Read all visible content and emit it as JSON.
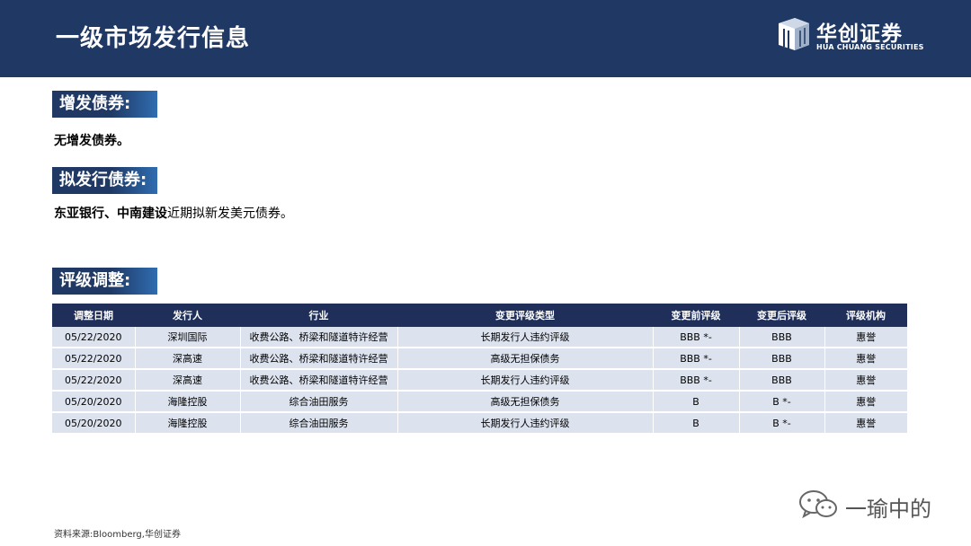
{
  "header": {
    "title": "一级市场发行信息",
    "logo_cn": "华创证券",
    "logo_en": "HUA CHUANG SECURITIES"
  },
  "sections": {
    "additional_issue": {
      "label": "增发债券:",
      "text": "无增发债券。"
    },
    "planned_issue": {
      "label": "拟发行债券:",
      "text_bold": "东亚银行、中南建设",
      "text_rest": "近期拟新发美元债券。"
    },
    "rating_changes": {
      "label": "评级调整:"
    }
  },
  "table": {
    "headers": [
      "调整日期",
      "发行人",
      "行业",
      "变更评级类型",
      "变更前评级",
      "变更后评级",
      "评级机构"
    ],
    "rows": [
      [
        "05/22/2020",
        "深圳国际",
        "收费公路、桥梁和隧道特许经营",
        "长期发行人违约评级",
        "BBB *-",
        "BBB",
        "惠誉"
      ],
      [
        "05/22/2020",
        "深高速",
        "收费公路、桥梁和隧道特许经营",
        "高级无担保债务",
        "BBB *-",
        "BBB",
        "惠誉"
      ],
      [
        "05/22/2020",
        "深高速",
        "收费公路、桥梁和隧道特许经营",
        "长期发行人违约评级",
        "BBB *-",
        "BBB",
        "惠誉"
      ],
      [
        "05/20/2020",
        "海隆控股",
        "综合油田服务",
        "高级无担保债务",
        "B",
        "B *-",
        "惠誉"
      ],
      [
        "05/20/2020",
        "海隆控股",
        "综合油田服务",
        "长期发行人违约评级",
        "B",
        "B *-",
        "惠誉"
      ]
    ]
  },
  "footer": {
    "source": "资料来源:Bloomberg,华创证券"
  },
  "watermark": {
    "text": "一瑜中的"
  },
  "colors": {
    "header_bg": "#1f3864",
    "table_header_bg": "#1f2f5a",
    "table_row_bg": "#dce3ef"
  }
}
